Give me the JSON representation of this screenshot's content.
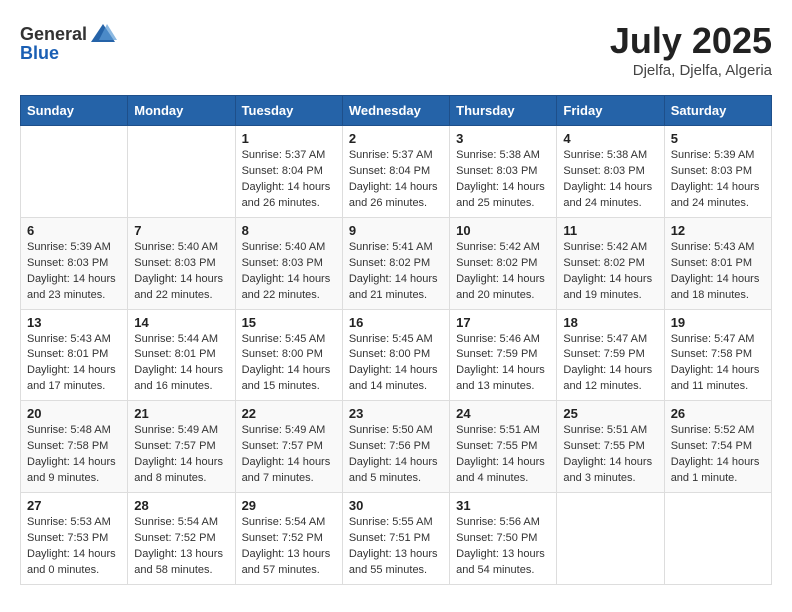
{
  "header": {
    "logo_general": "General",
    "logo_blue": "Blue",
    "title": "July 2025",
    "location": "Djelfa, Djelfa, Algeria"
  },
  "weekdays": [
    "Sunday",
    "Monday",
    "Tuesday",
    "Wednesday",
    "Thursday",
    "Friday",
    "Saturday"
  ],
  "weeks": [
    [
      {
        "day": "",
        "sunrise": "",
        "sunset": "",
        "daylight": ""
      },
      {
        "day": "",
        "sunrise": "",
        "sunset": "",
        "daylight": ""
      },
      {
        "day": "1",
        "sunrise": "Sunrise: 5:37 AM",
        "sunset": "Sunset: 8:04 PM",
        "daylight": "Daylight: 14 hours and 26 minutes."
      },
      {
        "day": "2",
        "sunrise": "Sunrise: 5:37 AM",
        "sunset": "Sunset: 8:04 PM",
        "daylight": "Daylight: 14 hours and 26 minutes."
      },
      {
        "day": "3",
        "sunrise": "Sunrise: 5:38 AM",
        "sunset": "Sunset: 8:03 PM",
        "daylight": "Daylight: 14 hours and 25 minutes."
      },
      {
        "day": "4",
        "sunrise": "Sunrise: 5:38 AM",
        "sunset": "Sunset: 8:03 PM",
        "daylight": "Daylight: 14 hours and 24 minutes."
      },
      {
        "day": "5",
        "sunrise": "Sunrise: 5:39 AM",
        "sunset": "Sunset: 8:03 PM",
        "daylight": "Daylight: 14 hours and 24 minutes."
      }
    ],
    [
      {
        "day": "6",
        "sunrise": "Sunrise: 5:39 AM",
        "sunset": "Sunset: 8:03 PM",
        "daylight": "Daylight: 14 hours and 23 minutes."
      },
      {
        "day": "7",
        "sunrise": "Sunrise: 5:40 AM",
        "sunset": "Sunset: 8:03 PM",
        "daylight": "Daylight: 14 hours and 22 minutes."
      },
      {
        "day": "8",
        "sunrise": "Sunrise: 5:40 AM",
        "sunset": "Sunset: 8:03 PM",
        "daylight": "Daylight: 14 hours and 22 minutes."
      },
      {
        "day": "9",
        "sunrise": "Sunrise: 5:41 AM",
        "sunset": "Sunset: 8:02 PM",
        "daylight": "Daylight: 14 hours and 21 minutes."
      },
      {
        "day": "10",
        "sunrise": "Sunrise: 5:42 AM",
        "sunset": "Sunset: 8:02 PM",
        "daylight": "Daylight: 14 hours and 20 minutes."
      },
      {
        "day": "11",
        "sunrise": "Sunrise: 5:42 AM",
        "sunset": "Sunset: 8:02 PM",
        "daylight": "Daylight: 14 hours and 19 minutes."
      },
      {
        "day": "12",
        "sunrise": "Sunrise: 5:43 AM",
        "sunset": "Sunset: 8:01 PM",
        "daylight": "Daylight: 14 hours and 18 minutes."
      }
    ],
    [
      {
        "day": "13",
        "sunrise": "Sunrise: 5:43 AM",
        "sunset": "Sunset: 8:01 PM",
        "daylight": "Daylight: 14 hours and 17 minutes."
      },
      {
        "day": "14",
        "sunrise": "Sunrise: 5:44 AM",
        "sunset": "Sunset: 8:01 PM",
        "daylight": "Daylight: 14 hours and 16 minutes."
      },
      {
        "day": "15",
        "sunrise": "Sunrise: 5:45 AM",
        "sunset": "Sunset: 8:00 PM",
        "daylight": "Daylight: 14 hours and 15 minutes."
      },
      {
        "day": "16",
        "sunrise": "Sunrise: 5:45 AM",
        "sunset": "Sunset: 8:00 PM",
        "daylight": "Daylight: 14 hours and 14 minutes."
      },
      {
        "day": "17",
        "sunrise": "Sunrise: 5:46 AM",
        "sunset": "Sunset: 7:59 PM",
        "daylight": "Daylight: 14 hours and 13 minutes."
      },
      {
        "day": "18",
        "sunrise": "Sunrise: 5:47 AM",
        "sunset": "Sunset: 7:59 PM",
        "daylight": "Daylight: 14 hours and 12 minutes."
      },
      {
        "day": "19",
        "sunrise": "Sunrise: 5:47 AM",
        "sunset": "Sunset: 7:58 PM",
        "daylight": "Daylight: 14 hours and 11 minutes."
      }
    ],
    [
      {
        "day": "20",
        "sunrise": "Sunrise: 5:48 AM",
        "sunset": "Sunset: 7:58 PM",
        "daylight": "Daylight: 14 hours and 9 minutes."
      },
      {
        "day": "21",
        "sunrise": "Sunrise: 5:49 AM",
        "sunset": "Sunset: 7:57 PM",
        "daylight": "Daylight: 14 hours and 8 minutes."
      },
      {
        "day": "22",
        "sunrise": "Sunrise: 5:49 AM",
        "sunset": "Sunset: 7:57 PM",
        "daylight": "Daylight: 14 hours and 7 minutes."
      },
      {
        "day": "23",
        "sunrise": "Sunrise: 5:50 AM",
        "sunset": "Sunset: 7:56 PM",
        "daylight": "Daylight: 14 hours and 5 minutes."
      },
      {
        "day": "24",
        "sunrise": "Sunrise: 5:51 AM",
        "sunset": "Sunset: 7:55 PM",
        "daylight": "Daylight: 14 hours and 4 minutes."
      },
      {
        "day": "25",
        "sunrise": "Sunrise: 5:51 AM",
        "sunset": "Sunset: 7:55 PM",
        "daylight": "Daylight: 14 hours and 3 minutes."
      },
      {
        "day": "26",
        "sunrise": "Sunrise: 5:52 AM",
        "sunset": "Sunset: 7:54 PM",
        "daylight": "Daylight: 14 hours and 1 minute."
      }
    ],
    [
      {
        "day": "27",
        "sunrise": "Sunrise: 5:53 AM",
        "sunset": "Sunset: 7:53 PM",
        "daylight": "Daylight: 14 hours and 0 minutes."
      },
      {
        "day": "28",
        "sunrise": "Sunrise: 5:54 AM",
        "sunset": "Sunset: 7:52 PM",
        "daylight": "Daylight: 13 hours and 58 minutes."
      },
      {
        "day": "29",
        "sunrise": "Sunrise: 5:54 AM",
        "sunset": "Sunset: 7:52 PM",
        "daylight": "Daylight: 13 hours and 57 minutes."
      },
      {
        "day": "30",
        "sunrise": "Sunrise: 5:55 AM",
        "sunset": "Sunset: 7:51 PM",
        "daylight": "Daylight: 13 hours and 55 minutes."
      },
      {
        "day": "31",
        "sunrise": "Sunrise: 5:56 AM",
        "sunset": "Sunset: 7:50 PM",
        "daylight": "Daylight: 13 hours and 54 minutes."
      },
      {
        "day": "",
        "sunrise": "",
        "sunset": "",
        "daylight": ""
      },
      {
        "day": "",
        "sunrise": "",
        "sunset": "",
        "daylight": ""
      }
    ]
  ]
}
